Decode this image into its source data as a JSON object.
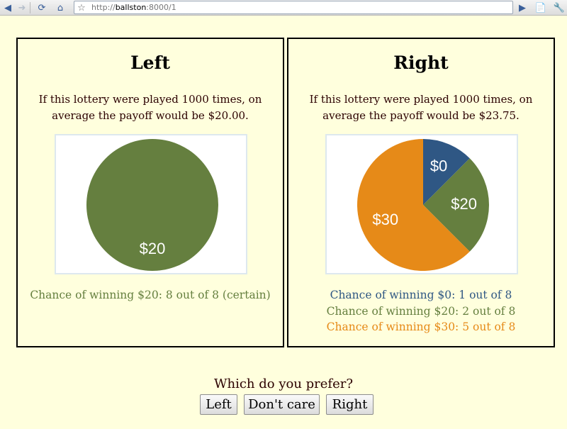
{
  "browser": {
    "url_scheme": "http://",
    "url_host": "ballston",
    "url_rest": ":8000/1"
  },
  "colors": {
    "orange": "#e68a18",
    "green": "#657f3f",
    "blue": "#2f5784"
  },
  "left": {
    "title": "Left",
    "desc": "If this lottery were played 1000 times, on average the payoff would be $20.00.",
    "chances": [
      {
        "text": "Chance of winning $20: 8 out of 8 (certain)",
        "color": "#657f3f"
      }
    ]
  },
  "right": {
    "title": "Right",
    "desc": "If this lottery were played 1000 times, on average the payoff would be $23.75.",
    "chances": [
      {
        "text": "Chance of winning $0: 1 out of 8",
        "color": "#2f5784"
      },
      {
        "text": "Chance of winning $20: 2 out of 8",
        "color": "#657f3f"
      },
      {
        "text": "Chance of winning $30: 5 out of 8",
        "color": "#e68a18"
      }
    ]
  },
  "chart_data": [
    {
      "type": "pie",
      "slices": [
        {
          "label": "$20",
          "value": 8,
          "color": "#657f3f"
        }
      ]
    },
    {
      "type": "pie",
      "slices": [
        {
          "label": "$0",
          "value": 1,
          "color": "#2f5784"
        },
        {
          "label": "$20",
          "value": 2,
          "color": "#657f3f"
        },
        {
          "label": "$30",
          "value": 5,
          "color": "#e68a18"
        }
      ]
    }
  ],
  "question": "Which do you prefer?",
  "buttons": {
    "left": "Left",
    "dont_care": "Don't care",
    "right": "Right"
  }
}
